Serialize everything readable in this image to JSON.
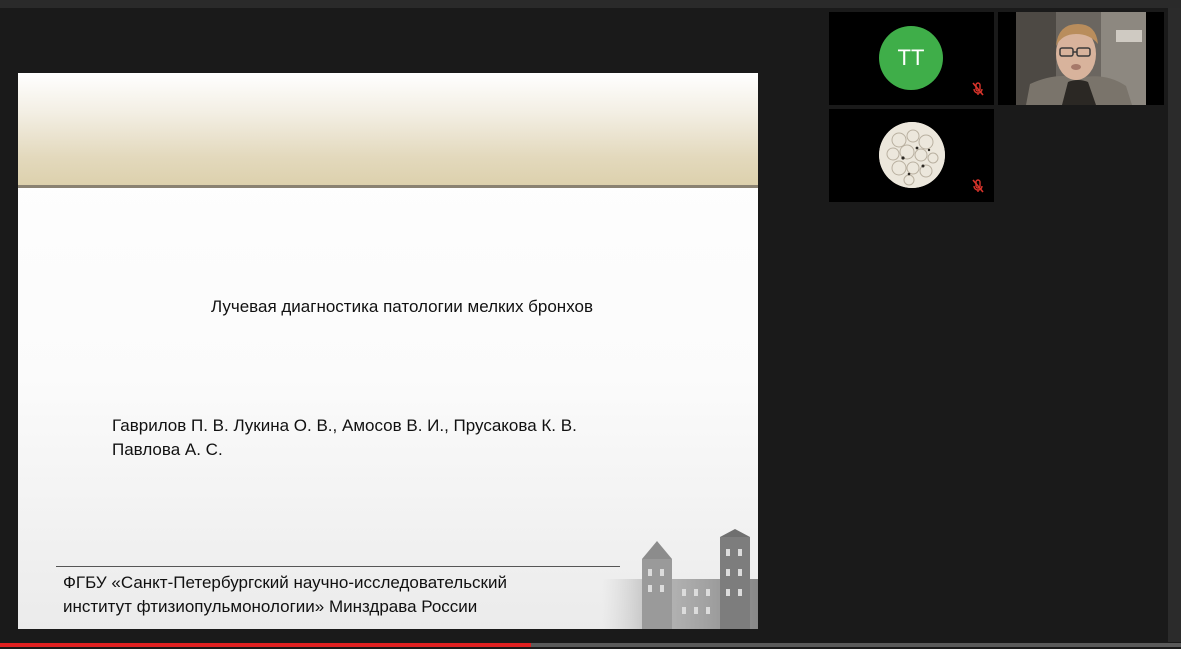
{
  "slide": {
    "title": "Лучевая диагностика патологии мелких бронхов",
    "authors_line1": "Гаврилов П. В. Лукина О. В., Амосов В. И., Прусакова К. В.",
    "authors_line2": "Павлова А. С.",
    "org_line1": "ФГБУ «Санкт-Петербургский научно-исследовательский",
    "org_line2": "институт фтизиопульмонологии» Минздрава России"
  },
  "participants": [
    {
      "initials": "TT",
      "avatar_color": "#3fae49",
      "mic": "muted"
    },
    {
      "type": "camera"
    },
    {
      "type": "image-avatar",
      "mic": "muted"
    }
  ],
  "colors": {
    "progress": "#e02020",
    "mic_muted": "#d9342b"
  },
  "video": {
    "progress_fraction": 0.45
  }
}
